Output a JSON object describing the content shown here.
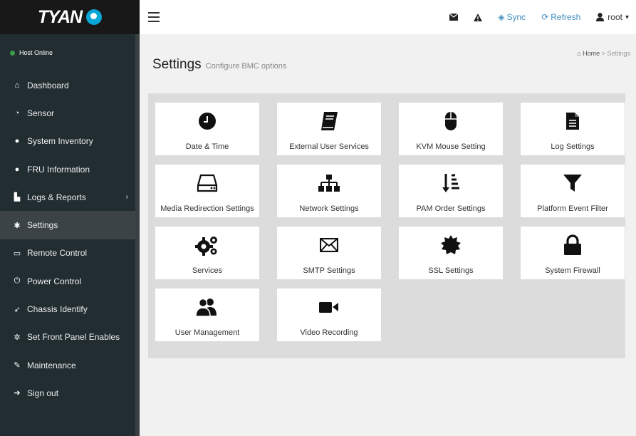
{
  "brand": {
    "logo_text": "TYAN"
  },
  "status": {
    "text": "Host Online"
  },
  "sidebar": {
    "items": [
      {
        "label": "Dashboard",
        "icon": "home-icon",
        "glyph": "⌂"
      },
      {
        "label": "Sensor",
        "icon": "dashboard-icon",
        "glyph": "◔"
      },
      {
        "label": "System Inventory",
        "icon": "info-icon",
        "glyph": "●"
      },
      {
        "label": "FRU Information",
        "icon": "info-icon",
        "glyph": "●"
      },
      {
        "label": "Logs & Reports",
        "icon": "bar-chart-icon",
        "glyph": "▙",
        "arrow": "›"
      },
      {
        "label": "Settings",
        "icon": "gear-icon",
        "glyph": "✱",
        "active": true
      },
      {
        "label": "Remote Control",
        "icon": "desktop-icon",
        "glyph": "▭"
      },
      {
        "label": "Power Control",
        "icon": "power-icon",
        "glyph": "⏻"
      },
      {
        "label": "Chassis Identify",
        "icon": "rocket-icon",
        "glyph": "➶"
      },
      {
        "label": "Set Front Panel Enables",
        "icon": "gears-icon",
        "glyph": "✲"
      },
      {
        "label": "Maintenance",
        "icon": "wrench-icon",
        "glyph": "✎"
      },
      {
        "label": "Sign out",
        "icon": "sign-out-icon",
        "glyph": "➔"
      }
    ]
  },
  "topbar": {
    "sync_label": "Sync",
    "refresh_label": "Refresh",
    "user_label": "root",
    "caret": "▾"
  },
  "page": {
    "title": "Settings",
    "subtitle": "Configure BMC options",
    "breadcrumb_home": "Home",
    "breadcrumb_sep": ">",
    "breadcrumb_current": "Settings"
  },
  "tiles": [
    {
      "label": "Date & Time",
      "icon": "clock-icon"
    },
    {
      "label": "External User Services",
      "icon": "book-icon"
    },
    {
      "label": "KVM Mouse Setting",
      "icon": "mouse-icon"
    },
    {
      "label": "Log Settings",
      "icon": "file-text-icon"
    },
    {
      "label": "Media Redirection Settings",
      "icon": "hdd-icon"
    },
    {
      "label": "Network Settings",
      "icon": "sitemap-icon"
    },
    {
      "label": "PAM Order Settings",
      "icon": "sort-amount-icon"
    },
    {
      "label": "Platform Event Filter",
      "icon": "filter-icon"
    },
    {
      "label": "Services",
      "icon": "cogs-icon"
    },
    {
      "label": "SMTP Settings",
      "icon": "envelope-icon"
    },
    {
      "label": "SSL Settings",
      "icon": "certificate-icon"
    },
    {
      "label": "System Firewall",
      "icon": "lock-icon"
    },
    {
      "label": "User Management",
      "icon": "users-icon"
    },
    {
      "label": "Video Recording",
      "icon": "video-camera-icon"
    }
  ]
}
